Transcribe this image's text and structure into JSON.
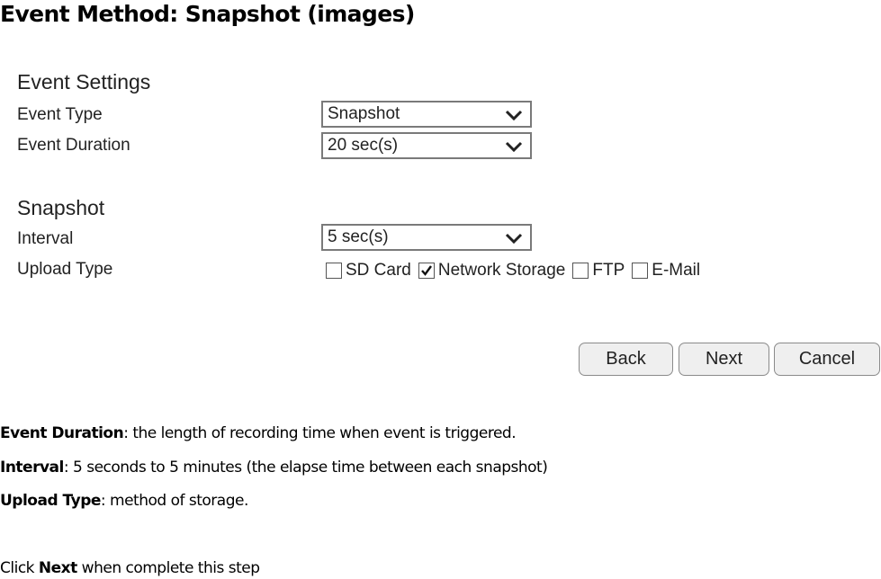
{
  "document": {
    "title": "Event Method: Snapshot (images)"
  },
  "form": {
    "event_settings": {
      "heading": "Event Settings",
      "event_type": {
        "label": "Event Type",
        "value": "Snapshot"
      },
      "event_duration": {
        "label": "Event Duration",
        "value": "20 sec(s)"
      }
    },
    "snapshot": {
      "heading": "Snapshot",
      "interval": {
        "label": "Interval",
        "value": "5 sec(s)"
      },
      "upload_type": {
        "label": "Upload Type",
        "options": [
          {
            "label": "SD Card",
            "checked": false
          },
          {
            "label": "Network Storage",
            "checked": true
          },
          {
            "label": "FTP",
            "checked": false
          },
          {
            "label": "E-Mail",
            "checked": false
          }
        ]
      }
    },
    "buttons": {
      "back": "Back",
      "next": "Next",
      "cancel": "Cancel"
    }
  },
  "notes": {
    "event_duration": {
      "term": "Event Duration",
      "text": ": the length of recording time when event is triggered."
    },
    "interval": {
      "term": "Interval",
      "text": ": 5 seconds to 5 minutes (the elapse time between each snapshot)"
    },
    "upload_type": {
      "term": "Upload Type",
      "text": ": method of storage."
    },
    "instruction": {
      "prefix": "Click ",
      "term": "Next",
      "suffix": " when complete this step"
    }
  }
}
